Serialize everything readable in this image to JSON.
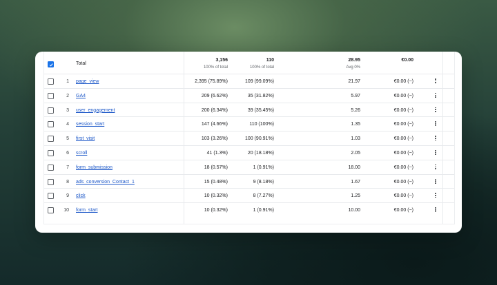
{
  "header": {
    "total_label": "Total",
    "event_count": "3,156",
    "event_count_sub": "100% of total",
    "total_users": "110",
    "total_users_sub": "100% of total",
    "events_per_user": "28.95",
    "events_per_user_sub": "Avg 0%",
    "revenue": "€0.00"
  },
  "rows": [
    {
      "index": "1",
      "name": "page_view",
      "event_count": "2,395 (75.89%)",
      "users": "109 (99.09%)",
      "per_user": "21.97",
      "revenue": "€0.00 (−)"
    },
    {
      "index": "2",
      "name": "GA4",
      "event_count": "209 (6.62%)",
      "users": "35 (31.82%)",
      "per_user": "5.97",
      "revenue": "€0.00 (−)"
    },
    {
      "index": "3",
      "name": "user_engagement",
      "event_count": "200 (6.34%)",
      "users": "39 (35.45%)",
      "per_user": "5.26",
      "revenue": "€0.00 (−)"
    },
    {
      "index": "4",
      "name": "session_start",
      "event_count": "147 (4.66%)",
      "users": "110 (100%)",
      "per_user": "1.35",
      "revenue": "€0.00 (−)"
    },
    {
      "index": "5",
      "name": "first_visit",
      "event_count": "103 (3.26%)",
      "users": "100 (90.91%)",
      "per_user": "1.03",
      "revenue": "€0.00 (−)"
    },
    {
      "index": "6",
      "name": "scroll",
      "event_count": "41 (1.3%)",
      "users": "20 (18.18%)",
      "per_user": "2.05",
      "revenue": "€0.00 (−)"
    },
    {
      "index": "7",
      "name": "form_submission",
      "event_count": "18 (0.57%)",
      "users": "1 (0.91%)",
      "per_user": "18.00",
      "revenue": "€0.00 (−)"
    },
    {
      "index": "8",
      "name": "ads_conversion_Contact_1",
      "event_count": "15 (0.48%)",
      "users": "9 (8.18%)",
      "per_user": "1.67",
      "revenue": "€0.00 (−)"
    },
    {
      "index": "9",
      "name": "click",
      "event_count": "10 (0.32%)",
      "users": "8 (7.27%)",
      "per_user": "1.25",
      "revenue": "€0.00 (−)"
    },
    {
      "index": "10",
      "name": "form_start",
      "event_count": "10 (0.32%)",
      "users": "1 (0.91%)",
      "per_user": "10.00",
      "revenue": "€0.00 (−)"
    }
  ],
  "colors": {
    "accent": "#1a73e8",
    "link": "#1a56c8"
  },
  "icons": {
    "select_all": "checkbox-checked-icon",
    "row_menu": "more-vert-icon"
  }
}
